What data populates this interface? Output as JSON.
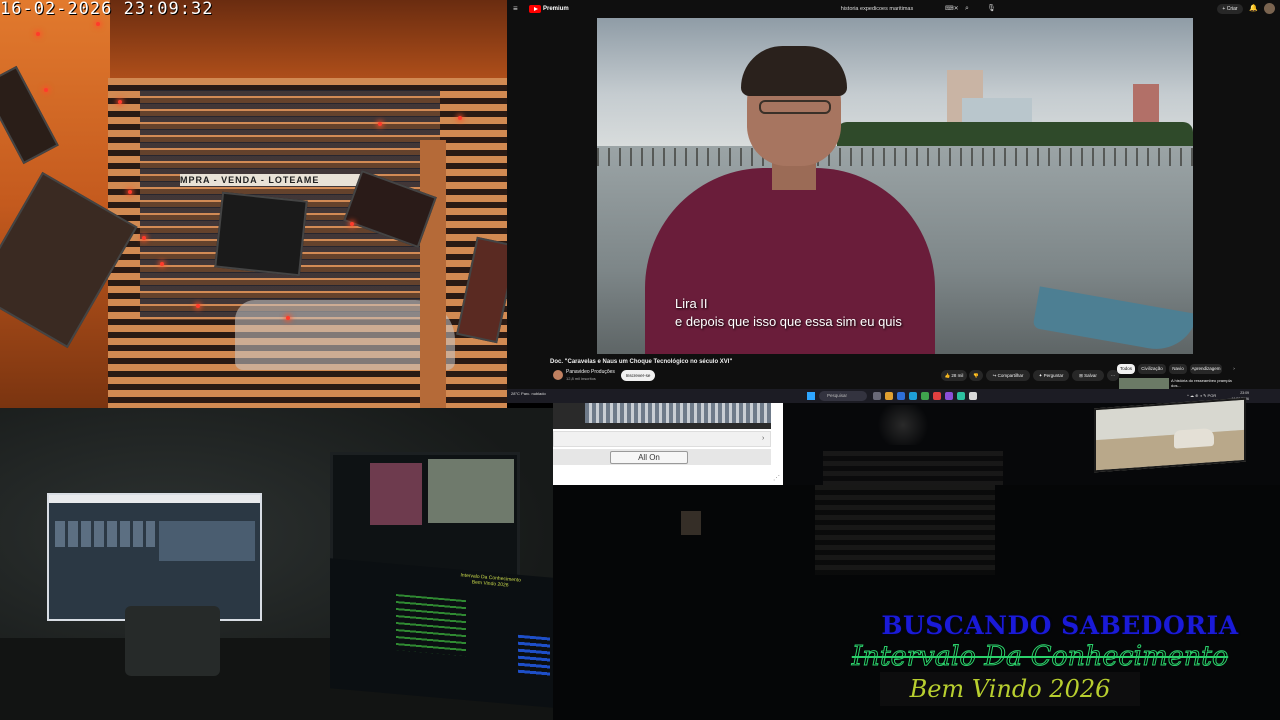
{
  "cam_top_left": {
    "timestamp": "16-02-2026  23:09:32",
    "sign_text": "MPRA - VENDA - LOTEAME"
  },
  "youtube": {
    "logo_text": "Premium",
    "search_query": "historia expedicoes maritimas",
    "create_label": "+ Criar",
    "subtitle_speaker": "Lira II",
    "subtitle_text": "e depois que isso que essa sim eu quis",
    "video_title": "Doc. \"Caravelas e Naus um Choque Tecnológico no século XVI\"",
    "channel_name": "Panavideo Produções",
    "channel_subscribers": "12,8 mil inscritos",
    "subscribe_label": "Inscrever-se",
    "like_label": "28 mil",
    "share_label": "Compartilhar",
    "ask_label": "Perguntar",
    "save_label": "Salvar",
    "more_label": "···",
    "chips": [
      "Todos",
      "Civilização",
      "Navio",
      "Aprendizagem"
    ],
    "chip_next": "›",
    "recommended_title": "A história do resseambeo prampla dos..."
  },
  "taskbar": {
    "weather": "28°C Parc. nublado",
    "search_placeholder": "Pesquisar",
    "tray": "^ ☁ ⊕ ◑ ✎ POR",
    "clock_time": "23:09",
    "clock_date": "16/02/2026",
    "app_colors": [
      "#6a6a78",
      "#e0a030",
      "#2e6fd8",
      "#1e9fd8",
      "#3fa34d",
      "#e04040",
      "#8a4fd8",
      "#2cc0a0",
      "#d8d8d8"
    ]
  },
  "mini_panel": {
    "button_label": "All On",
    "scroll_arrow": "›",
    "grip": "⋰"
  },
  "studio": {
    "monitor_overlay_text": "Intervalo Da Conhecimento Bem Vindo 2026"
  },
  "overlay": {
    "title": "BUSCANDO SABEDORIA",
    "subtitle": "Intervalo Da Conhecimento",
    "welcome": "Bem Vindo 2026"
  },
  "colors": {
    "overlay_title": "#1a1ad8",
    "overlay_subtitle_stroke": "#2bd06b",
    "overlay_welcome": "#b8cf2f",
    "youtube_red": "#ff0000"
  }
}
